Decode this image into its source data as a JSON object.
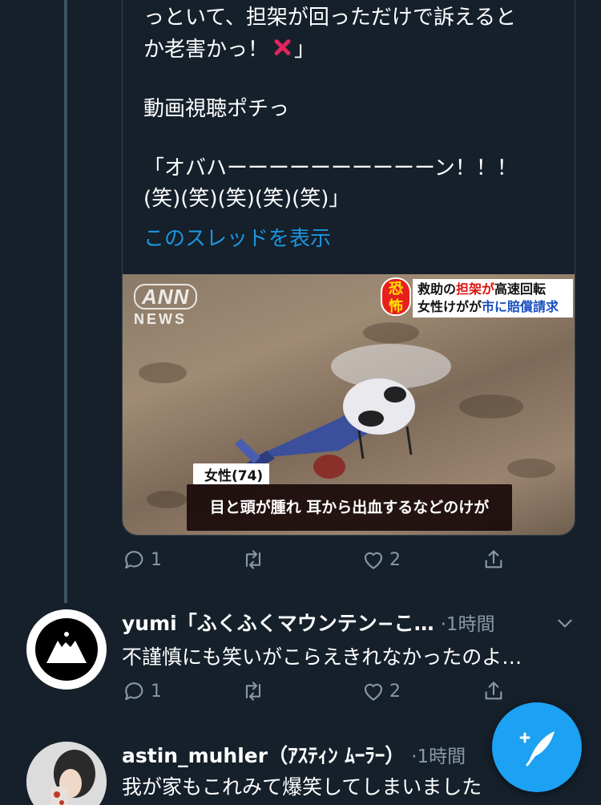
{
  "quote": {
    "line1": "っといて、担架が回っただけで訴えると",
    "line2": "か老害かっ！",
    "line2_end": "」",
    "line3": "動画視聴ポチっ",
    "line4": "「オバハーーーーーーーーーーン！！！",
    "line5": "(笑)(笑)(笑)(笑)(笑)」",
    "show_thread": "このスレッドを表示",
    "media": {
      "logo_top": "ANN",
      "logo_bottom": "NEWS",
      "badge": "恐怖",
      "headline_part1": "救助の",
      "headline_red": "担架が",
      "headline_part2": "高速回転",
      "headline_line2_part1": "女性けがが",
      "headline_blue": "市に賠償請求",
      "victim_label": "女性(74)",
      "caption": "目と頭が腫れ 耳から出血するなどのけが"
    }
  },
  "actions1": {
    "reply_count": "1",
    "like_count": "2"
  },
  "tweet1": {
    "name": "yumi「ふくふくマウンテン−こ…",
    "time": "·1時間",
    "text": "不謹慎にも笑いがこらえきれなかったのよ…"
  },
  "actions2": {
    "reply_count": "1",
    "like_count": "2"
  },
  "tweet2": {
    "name": "astin_muhler（ｱｽﾃｨﾝ ﾑｰﾗｰ）",
    "time": "·1時間",
    "text": "我が家もこれみて爆笑してしまいました"
  },
  "colors": {
    "background": "#15202b",
    "accent": "#1da1f2",
    "link": "#1b95e0",
    "muted": "#8899a6"
  }
}
